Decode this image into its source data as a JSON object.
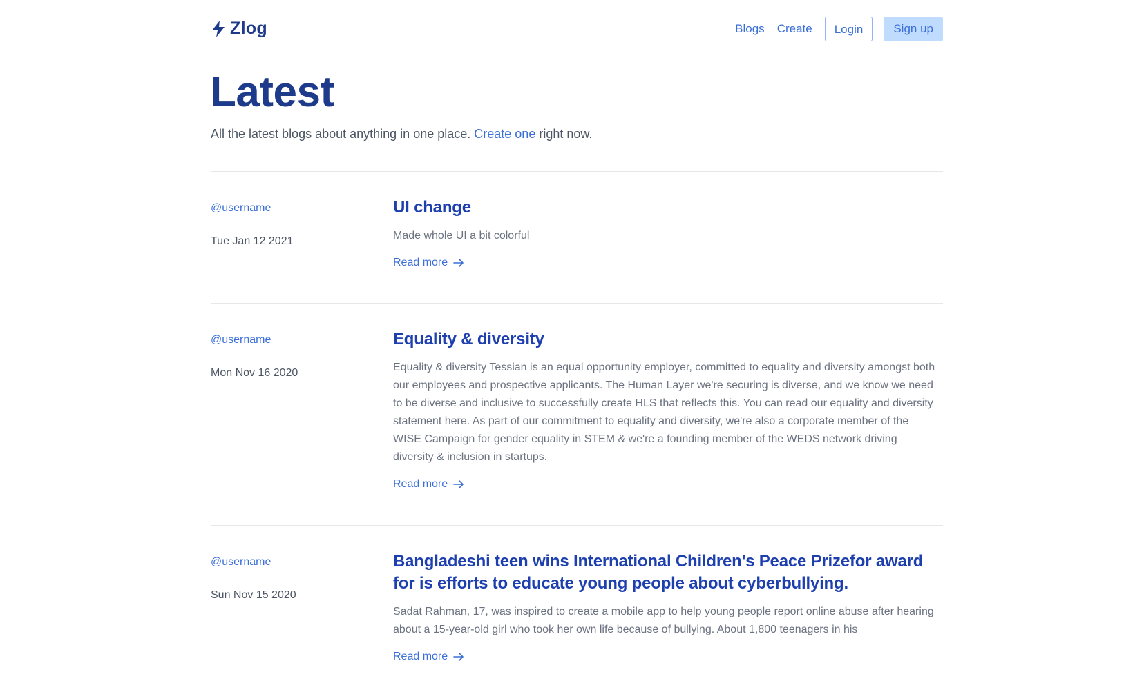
{
  "header": {
    "brand": "Zlog",
    "nav": {
      "blogs": "Blogs",
      "create": "Create",
      "login": "Login",
      "signup": "Sign up"
    }
  },
  "hero": {
    "title": "Latest",
    "subtitle_before": "All the latest blogs about anything in one place. ",
    "subtitle_link": "Create one",
    "subtitle_after": " right now."
  },
  "posts": [
    {
      "author": "@username",
      "date": "Tue Jan 12 2021",
      "title": "UI change",
      "excerpt": "Made whole UI a bit colorful",
      "read_more": "Read more"
    },
    {
      "author": "@username",
      "date": "Mon Nov 16 2020",
      "title": "Equality & diversity",
      "excerpt": "Equality & diversity Tessian is an equal opportunity employer, committed to equality and diversity amongst both our employees and prospective applicants. The Human Layer we're securing is diverse, and we know we need to be diverse and inclusive to successfully create HLS that reflects this. You can read our equality and diversity statement here. As part of our commitment to equality and diversity, we're also a corporate member of the WISE Campaign for gender equality in STEM & we're a founding member of the WEDS network driving diversity & inclusion in startups.",
      "read_more": "Read more"
    },
    {
      "author": "@username",
      "date": "Sun Nov 15 2020",
      "title": "Bangladeshi teen wins International Children's Peace Prizefor award for is efforts to educate young people about cyberbullying.",
      "excerpt": "Sadat Rahman, 17, was inspired to create a mobile app to help young people report online abuse after hearing about a 15-year-old girl who took her own life because of bullying. About 1,800 teenagers in his",
      "read_more": "Read more"
    }
  ],
  "icons": {
    "brand": "lightning-bolt-icon",
    "read_more": "arrow-right-icon"
  },
  "colors": {
    "brand": "#1e3a8a",
    "accent": "#3b6fd8",
    "signup_bg": "#bfdbfe"
  }
}
